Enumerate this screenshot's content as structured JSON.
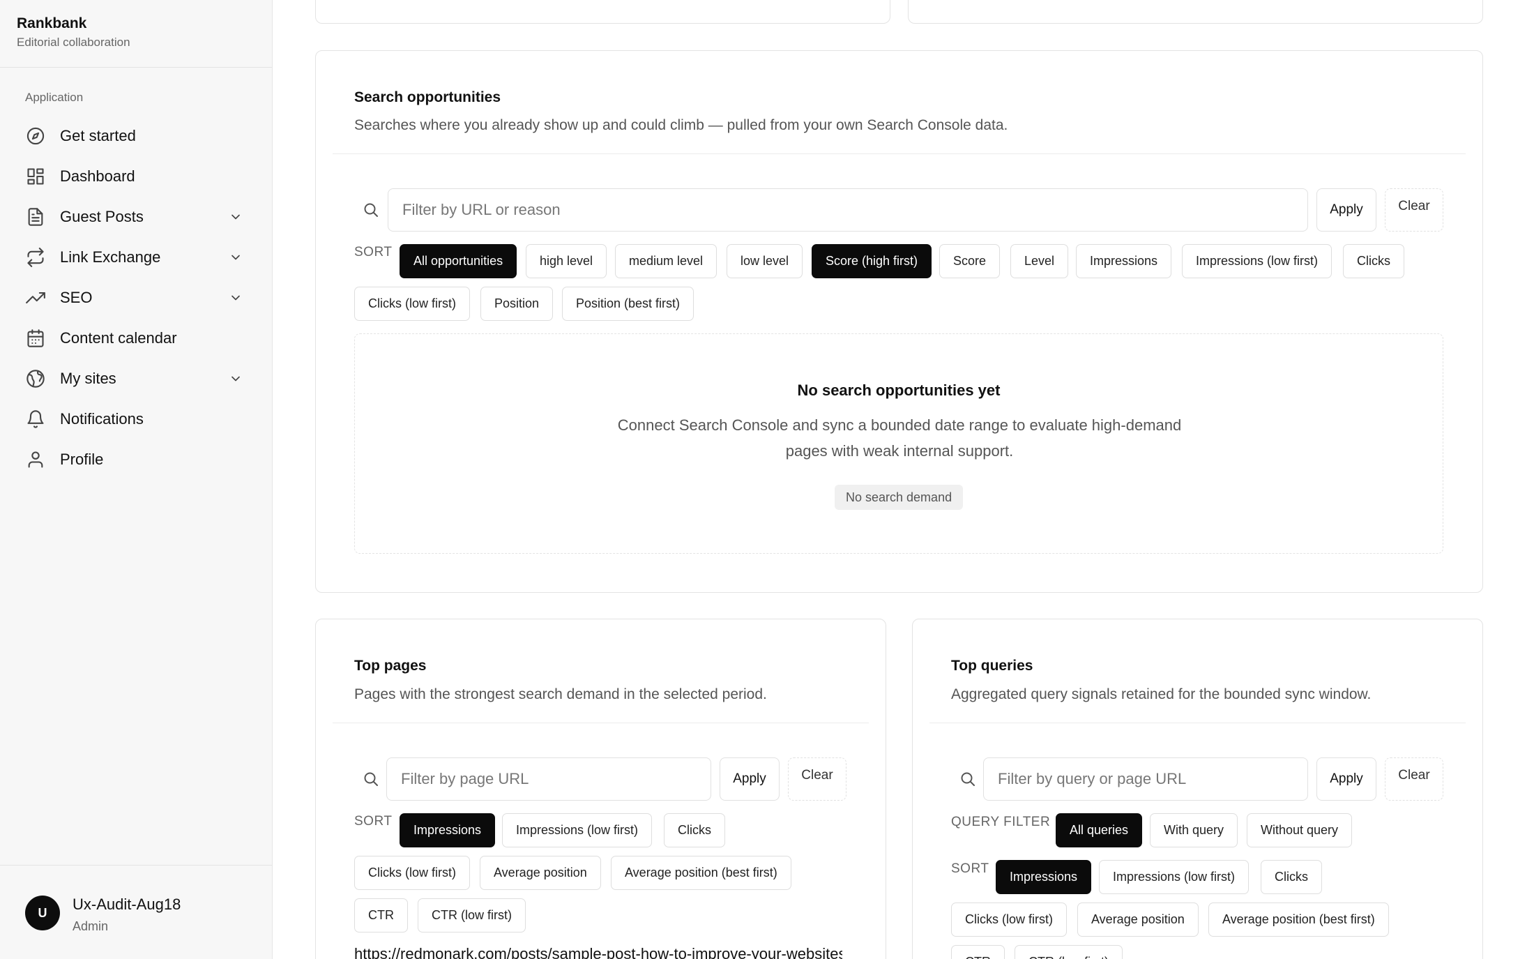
{
  "brand": {
    "name": "Rankbank",
    "subtitle": "Editorial collaboration"
  },
  "sidebar": {
    "section_label": "Application",
    "items": [
      {
        "label": "Get started",
        "icon": "compass-icon",
        "has_chevron": false
      },
      {
        "label": "Dashboard",
        "icon": "grid-icon",
        "has_chevron": false
      },
      {
        "label": "Guest Posts",
        "icon": "document-icon",
        "has_chevron": true
      },
      {
        "label": "Link Exchange",
        "icon": "repeat-icon",
        "has_chevron": true
      },
      {
        "label": "SEO",
        "icon": "trending-up-icon",
        "has_chevron": true
      },
      {
        "label": "Content calendar",
        "icon": "calendar-icon",
        "has_chevron": false
      },
      {
        "label": "My sites",
        "icon": "globe-icon",
        "has_chevron": true
      },
      {
        "label": "Notifications",
        "icon": "bell-icon",
        "has_chevron": false
      },
      {
        "label": "Profile",
        "icon": "user-icon",
        "has_chevron": false
      }
    ]
  },
  "user": {
    "initial": "U",
    "name": "Ux-Audit-Aug18",
    "role": "Admin"
  },
  "search_opportunities": {
    "title": "Search opportunities",
    "description": "Searches where you already show up and could climb — pulled from your own Search Console data.",
    "filter_placeholder": "Filter by URL or reason",
    "apply_label": "Apply",
    "clear_label": "Clear",
    "sort_label": "SORT",
    "chips": [
      {
        "label": "All opportunities",
        "active": true
      },
      {
        "label": "high level",
        "active": false
      },
      {
        "label": "medium level",
        "active": false
      },
      {
        "label": "low level",
        "active": false
      },
      {
        "label": "Score (high first)",
        "active": true
      },
      {
        "label": "Score",
        "active": false
      },
      {
        "label": "Level",
        "active": false
      },
      {
        "label": "Impressions",
        "active": false
      },
      {
        "label": "Impressions (low first)",
        "active": false
      },
      {
        "label": "Clicks",
        "active": false
      },
      {
        "label": "Clicks (low first)",
        "active": false
      },
      {
        "label": "Position",
        "active": false
      },
      {
        "label": "Position (best first)",
        "active": false
      }
    ],
    "empty": {
      "title": "No search opportunities yet",
      "description": "Connect Search Console and sync a bounded date range to evaluate high-demand pages with weak internal support.",
      "badge": "No search demand"
    }
  },
  "top_pages": {
    "title": "Top pages",
    "description": "Pages with the strongest search demand in the selected period.",
    "filter_placeholder": "Filter by page URL",
    "apply_label": "Apply",
    "clear_label": "Clear",
    "sort_label": "SORT",
    "chips": [
      {
        "label": "Impressions",
        "active": true
      },
      {
        "label": "Impressions (low first)",
        "active": false
      },
      {
        "label": "Clicks",
        "active": false
      },
      {
        "label": "Clicks (low first)",
        "active": false
      },
      {
        "label": "Average position",
        "active": false
      },
      {
        "label": "Average position (best first)",
        "active": false
      },
      {
        "label": "CTR",
        "active": false
      },
      {
        "label": "CTR (low first)",
        "active": false
      }
    ],
    "first_row_url": "https://redmonark.com/posts/sample-post-how-to-improve-your-websites-l"
  },
  "top_queries": {
    "title": "Top queries",
    "description": "Aggregated query signals retained for the bounded sync window.",
    "filter_placeholder": "Filter by query or page URL",
    "apply_label": "Apply",
    "clear_label": "Clear",
    "query_filter_label": "QUERY FILTER",
    "query_filter_chips": [
      {
        "label": "All queries",
        "active": true
      },
      {
        "label": "With query",
        "active": false
      },
      {
        "label": "Without query",
        "active": false
      }
    ],
    "sort_label": "SORT",
    "chips": [
      {
        "label": "Impressions",
        "active": true
      },
      {
        "label": "Impressions (low first)",
        "active": false
      },
      {
        "label": "Clicks",
        "active": false
      },
      {
        "label": "Clicks (low first)",
        "active": false
      },
      {
        "label": "Average position",
        "active": false
      },
      {
        "label": "Average position (best first)",
        "active": false
      },
      {
        "label": "CTR",
        "active": false
      },
      {
        "label": "CTR (low first)",
        "active": false
      }
    ]
  }
}
